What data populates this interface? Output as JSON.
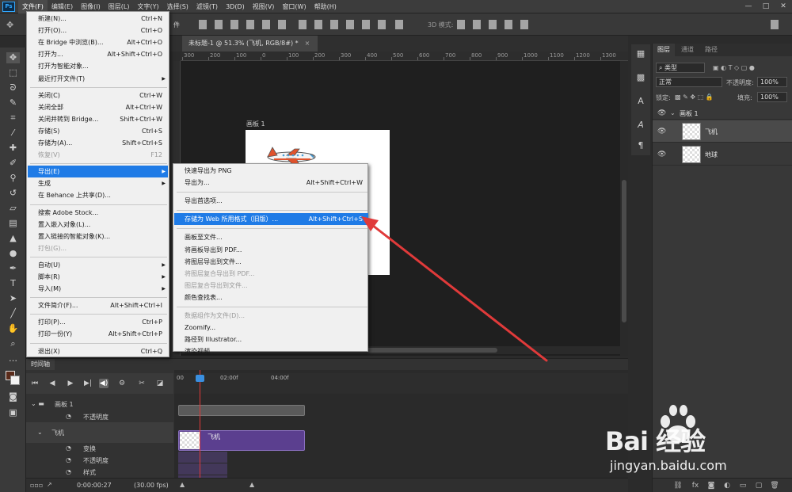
{
  "app": {
    "logo": "Ps",
    "menus": [
      "文件(F)",
      "编辑(E)",
      "图像(I)",
      "图层(L)",
      "文字(Y)",
      "选择(S)",
      "滤镜(T)",
      "3D(D)",
      "视图(V)",
      "窗口(W)",
      "帮助(H)"
    ],
    "active_menu": "文件(F)"
  },
  "options_bar": {
    "mode_label": "3D 模式:",
    "file_text": "件"
  },
  "document": {
    "tab_title": "未标题-1 @ 51.3% (飞机, RGB/8#) *",
    "close_glyph": "×",
    "artboard_label": "画板 1",
    "ruler_numbers": [
      "300",
      "200",
      "100",
      "0",
      "100",
      "200",
      "300",
      "400",
      "500",
      "600",
      "700",
      "800",
      "900",
      "1000",
      "1100",
      "1200",
      "1300"
    ]
  },
  "file_menu": {
    "items": [
      {
        "label": "新建(N)...",
        "shortcut": "Ctrl+N"
      },
      {
        "label": "打开(O)...",
        "shortcut": "Ctrl+O"
      },
      {
        "label": "在 Bridge 中浏览(B)...",
        "shortcut": "Alt+Ctrl+O"
      },
      {
        "label": "打开为...",
        "shortcut": "Alt+Shift+Ctrl+O"
      },
      {
        "label": "打开为智能对象...",
        "shortcut": ""
      },
      {
        "label": "最近打开文件(T)",
        "shortcut": "",
        "submenu": true
      },
      {
        "sep": true
      },
      {
        "label": "关闭(C)",
        "shortcut": "Ctrl+W"
      },
      {
        "label": "关闭全部",
        "shortcut": "Alt+Ctrl+W"
      },
      {
        "label": "关闭并转到 Bridge...",
        "shortcut": "Shift+Ctrl+W"
      },
      {
        "label": "存储(S)",
        "shortcut": "Ctrl+S"
      },
      {
        "label": "存储为(A)...",
        "shortcut": "Shift+Ctrl+S"
      },
      {
        "label": "恢复(V)",
        "shortcut": "F12",
        "disabled": true
      },
      {
        "sep": true
      },
      {
        "label": "导出(E)",
        "shortcut": "",
        "submenu": true,
        "highlighted": true
      },
      {
        "label": "生成",
        "shortcut": "",
        "submenu": true
      },
      {
        "label": "在 Behance 上共享(D)...",
        "shortcut": ""
      },
      {
        "sep": true
      },
      {
        "label": "搜索 Adobe Stock...",
        "shortcut": ""
      },
      {
        "label": "置入嵌入对象(L)...",
        "shortcut": ""
      },
      {
        "label": "置入链接的智能对象(K)...",
        "shortcut": ""
      },
      {
        "label": "打包(G)...",
        "shortcut": "",
        "disabled": true
      },
      {
        "sep": true
      },
      {
        "label": "自动(U)",
        "shortcut": "",
        "submenu": true
      },
      {
        "label": "脚本(R)",
        "shortcut": "",
        "submenu": true
      },
      {
        "label": "导入(M)",
        "shortcut": "",
        "submenu": true
      },
      {
        "sep": true
      },
      {
        "label": "文件简介(F)...",
        "shortcut": "Alt+Shift+Ctrl+I"
      },
      {
        "sep": true
      },
      {
        "label": "打印(P)...",
        "shortcut": "Ctrl+P"
      },
      {
        "label": "打印一份(Y)",
        "shortcut": "Alt+Shift+Ctrl+P"
      },
      {
        "sep": true
      },
      {
        "label": "退出(X)",
        "shortcut": "Ctrl+Q"
      }
    ]
  },
  "export_submenu": {
    "items": [
      {
        "label": "快速导出为 PNG",
        "shortcut": ""
      },
      {
        "label": "导出为...",
        "shortcut": "Alt+Shift+Ctrl+W"
      },
      {
        "sep": true
      },
      {
        "label": "导出首选项...",
        "shortcut": ""
      },
      {
        "sep": true
      },
      {
        "label": "存储为 Web 所用格式（旧版）...",
        "shortcut": "Alt+Shift+Ctrl+S",
        "highlighted": true
      },
      {
        "sep": true
      },
      {
        "label": "画板至文件...",
        "shortcut": ""
      },
      {
        "label": "将画板导出到 PDF...",
        "shortcut": ""
      },
      {
        "label": "将图层导出到文件...",
        "shortcut": ""
      },
      {
        "label": "将图层复合导出到 PDF...",
        "shortcut": "",
        "disabled": true
      },
      {
        "label": "图层复合导出到文件...",
        "shortcut": "",
        "disabled": true
      },
      {
        "label": "颜色查找表...",
        "shortcut": ""
      },
      {
        "sep": true
      },
      {
        "label": "数据组作为文件(D)...",
        "shortcut": "",
        "disabled": true
      },
      {
        "label": "Zoomify...",
        "shortcut": ""
      },
      {
        "label": "路径到 Illustrator...",
        "shortcut": ""
      },
      {
        "label": "渲染视频...",
        "shortcut": ""
      }
    ]
  },
  "layers_panel": {
    "tabs": [
      "图层",
      "通道",
      "路径"
    ],
    "filter_label": "类型",
    "blend_mode": "正常",
    "opacity_label": "不透明度:",
    "opacity_value": "100%",
    "lock_label": "锁定:",
    "fill_label": "填充:",
    "fill_value": "100%",
    "group_name": "画板 1",
    "layers": [
      {
        "name": "飞机",
        "selected": true
      },
      {
        "name": "地球",
        "selected": false
      }
    ]
  },
  "timeline": {
    "tab_label": "时间轴",
    "ruler": [
      "00",
      "02:00f",
      "04:00f"
    ],
    "rows": [
      {
        "label": "画板 1",
        "kind": "group"
      },
      {
        "label": "不透明度",
        "kind": "prop"
      },
      {
        "label": "飞机",
        "kind": "layer"
      },
      {
        "label": "变换",
        "kind": "prop"
      },
      {
        "label": "不透明度",
        "kind": "prop"
      },
      {
        "label": "样式",
        "kind": "prop"
      }
    ],
    "clip_name": "飞机",
    "current_time": "0:00:00:27",
    "fps": "(30.00 fps)"
  },
  "watermark": {
    "logo": "Bai 经验",
    "url": "jingyan.baidu.com"
  },
  "colors": {
    "menu_highlight": "#1f7be6",
    "arrow": "#e03a3a",
    "clip": "#5b3f8f"
  }
}
